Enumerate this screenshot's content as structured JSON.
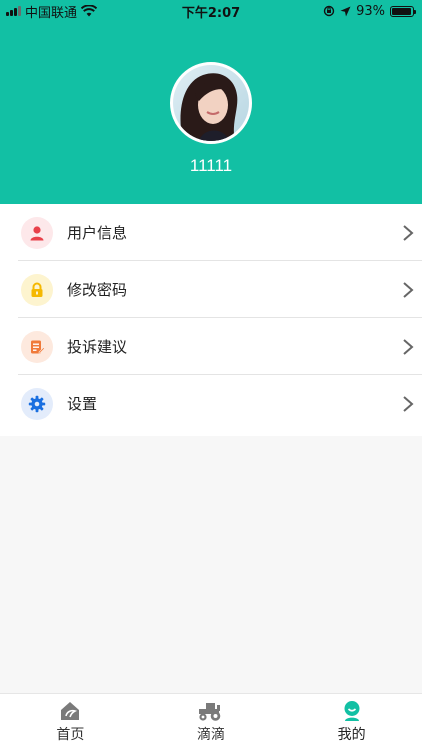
{
  "status_bar": {
    "carrier": "中国联通",
    "time": "下午2:07",
    "battery_text": "93%",
    "battery_level": 0.93
  },
  "profile": {
    "username": "11111"
  },
  "colors": {
    "brand": "#12c0a4",
    "user_info": "#e8404a",
    "password": "#f5b800",
    "feedback": "#f07a3a",
    "settings": "#1a6fe0"
  },
  "menu": {
    "items": [
      {
        "label": "用户信息",
        "icon": "user-icon"
      },
      {
        "label": "修改密码",
        "icon": "lock-icon"
      },
      {
        "label": "投诉建议",
        "icon": "document-edit-icon"
      },
      {
        "label": "设置",
        "icon": "gear-icon"
      }
    ]
  },
  "tabbar": {
    "tabs": [
      {
        "label": "首页",
        "icon": "home-icon"
      },
      {
        "label": "滴滴",
        "icon": "tractor-icon"
      },
      {
        "label": "我的",
        "icon": "profile-icon"
      }
    ],
    "active": "我的"
  }
}
